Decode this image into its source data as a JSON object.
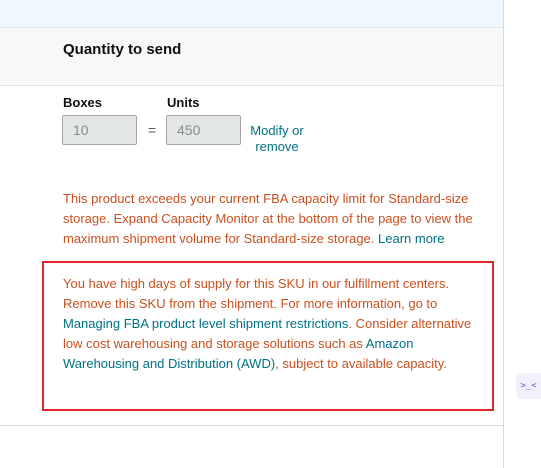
{
  "section": {
    "title": "Quantity to send"
  },
  "quantity": {
    "boxes_label": "Boxes",
    "units_label": "Units",
    "boxes_value": "10",
    "equals": "=",
    "units_value": "450",
    "modify_label": "Modify or remove"
  },
  "warnings": {
    "capacity_text": "This product exceeds your current FBA capacity limit for Standard-size storage. Expand Capacity Monitor at the bottom of the page to view the maximum shipment volume for Standard-size storage. ",
    "capacity_link": "Learn more",
    "supply_text_1": "You have high days of supply for this SKU in our fulfillment centers. Remove this SKU from the shipment. For more information, go to ",
    "supply_link_1": "Managing FBA product level shipment restrictions",
    "supply_text_2": ". Consider alternative low cost warehousing and storage solutions such as ",
    "supply_link_2": "Amazon Warehousing and Distribution (AWD)",
    "supply_text_3": ", subject to available capacity."
  },
  "side_tab": {
    "icon": "code-chevrons-icon",
    "glyph": ">_<"
  },
  "colors": {
    "warning_text": "#c7511f",
    "link": "#007185",
    "highlight_border": "#e1262d"
  }
}
